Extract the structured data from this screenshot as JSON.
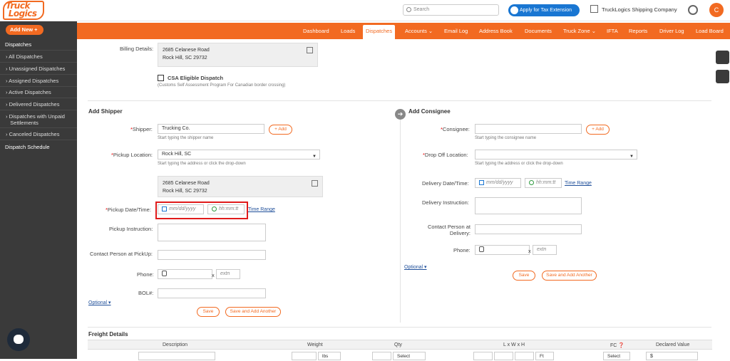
{
  "brand": {
    "line1": "Truck",
    "line2": "Logics"
  },
  "header": {
    "search_placeholder": "Search",
    "tax_button": "Apply for Tax Extension",
    "company": "TruckLogics Shipping Company",
    "avatar_initial": "C"
  },
  "nav": [
    "Dashboard",
    "Loads",
    "Dispatches",
    "Accounts ⌄",
    "Email Log",
    "Address Book",
    "Documents",
    "Truck Zone ⌄",
    "IFTA",
    "Reports",
    "Driver Log",
    "Load Board"
  ],
  "sidebar": {
    "add_new": "Add New  +",
    "heading": "Dispatches",
    "items": [
      "All Dispatches",
      "Unassigned Dispatches",
      "Assigned Dispatches",
      "Active Dispatches",
      "Delivered Dispatches",
      "Dispatches with Unpaid",
      "Settlements",
      "Canceled Dispatches"
    ],
    "schedule": "Dispatch Schedule"
  },
  "billing": {
    "label": "Billing Details:",
    "line1": "2685 Celanese Road",
    "line2": "Rock Hill, SC 29732",
    "csa_label": "CSA Eligible Dispatch",
    "csa_note": "(Customs Self Assessment Program For Canadian border crossing)"
  },
  "shipper": {
    "title": "Add Shipper",
    "shipper_label": "Shipper:",
    "shipper_value": "Trucking Co.",
    "shipper_hint": "Start typing the shipper name",
    "add": "+ Add",
    "pickup_location_label": "Pickup Location:",
    "pickup_location_value": "Rock Hill, SC",
    "pickup_hint": "Start typing the address or click the drop-down",
    "addr_line1": "2685 Celanese Road",
    "addr_line2": "Rock Hill, SC 29732",
    "date_label": "Pickup Date/Time:",
    "date_placeholder": "mm/dd/yyyy",
    "time_placeholder": "hh:mm:tt",
    "time_range": "Time Range",
    "instruction_label": "Pickup Instruction:",
    "contact_label": "Contact Person at PickUp:",
    "phone_label": "Phone:",
    "x": "x",
    "extn": "extn",
    "bol_label": "BOL#:",
    "optional": "Optional ▾",
    "save": "Save",
    "save_another": "Save and Add Another"
  },
  "consignee": {
    "title": "Add Consignee",
    "consignee_label": "Consignee:",
    "consignee_hint": "Start typing the consignee name",
    "add": "+ Add",
    "dropoff_label": "Drop Off Location:",
    "dropoff_hint": "Start typing the address or click the drop-down",
    "date_label": "Delivery Date/Time:",
    "date_placeholder": "mm/dd/yyyy",
    "time_placeholder": "hh:mm:tt",
    "time_range": "Time Range",
    "instruction_label": "Delivery Instruction:",
    "contact_label1": "Contact Person at",
    "contact_label2": "Delivery:",
    "phone_label": "Phone:",
    "x": "x",
    "extn": "extn",
    "optional": "Optional ▾",
    "save": "Save",
    "save_another": "Save and Add Another"
  },
  "freight": {
    "title": "Freight Details",
    "cols": [
      "Description",
      "Weight",
      "Qty",
      "L x W x H",
      "FC",
      "Declared Value"
    ],
    "lbs": "lbs",
    "select": "Select",
    "ft": "Ft",
    "dollar": "$"
  }
}
